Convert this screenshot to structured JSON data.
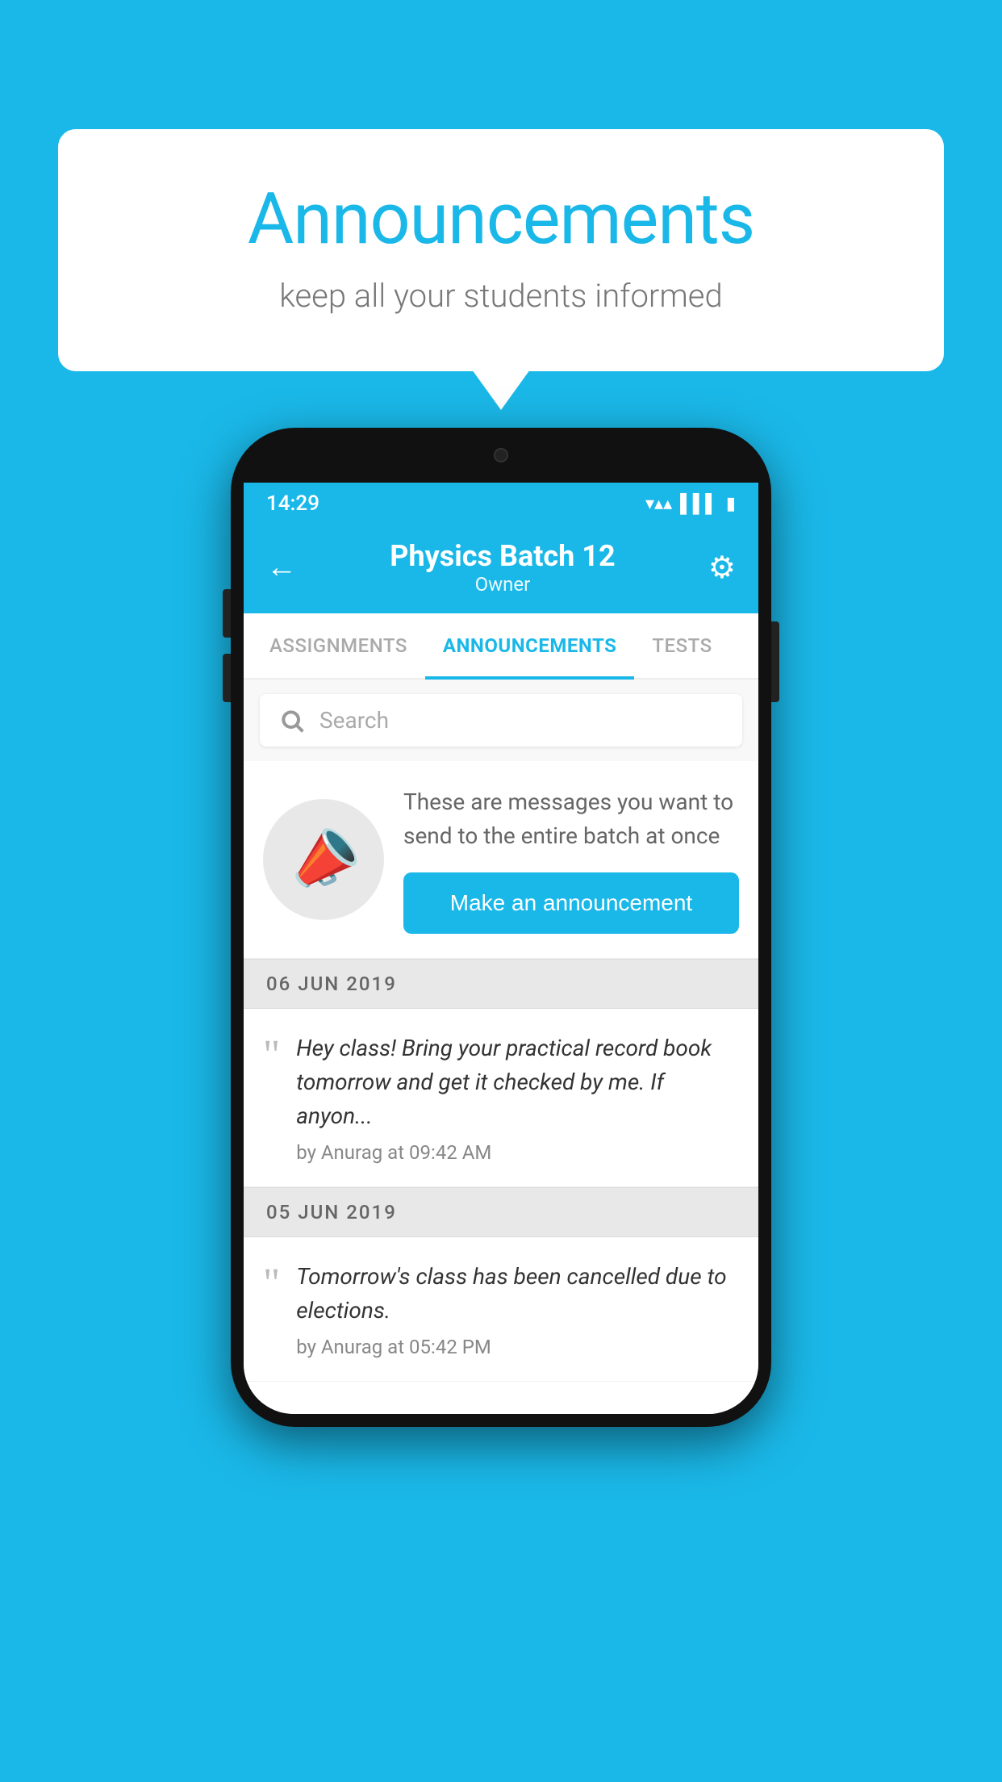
{
  "background_color": "#1ab8e8",
  "speech_bubble": {
    "title": "Announcements",
    "subtitle": "keep all your students informed"
  },
  "phone": {
    "status_bar": {
      "time": "14:29",
      "icons": [
        "wifi",
        "signal",
        "battery"
      ]
    },
    "header": {
      "title": "Physics Batch 12",
      "subtitle": "Owner",
      "back_label": "←",
      "gear_label": "⚙"
    },
    "tabs": [
      {
        "label": "ASSIGNMENTS",
        "active": false
      },
      {
        "label": "ANNOUNCEMENTS",
        "active": true
      },
      {
        "label": "TESTS",
        "active": false
      },
      {
        "label": "...",
        "active": false
      }
    ],
    "search": {
      "placeholder": "Search"
    },
    "announcement_prompt": {
      "description": "These are messages you want to send to the entire batch at once",
      "button_label": "Make an announcement"
    },
    "announcement_entries": [
      {
        "date": "06  JUN  2019",
        "message": "Hey class! Bring your practical record book tomorrow and get it checked by me. If anyon...",
        "author": "by Anurag at 09:42 AM"
      },
      {
        "date": "05  JUN  2019",
        "message": "Tomorrow's class has been cancelled due to elections.",
        "author": "by Anurag at 05:42 PM"
      }
    ]
  }
}
